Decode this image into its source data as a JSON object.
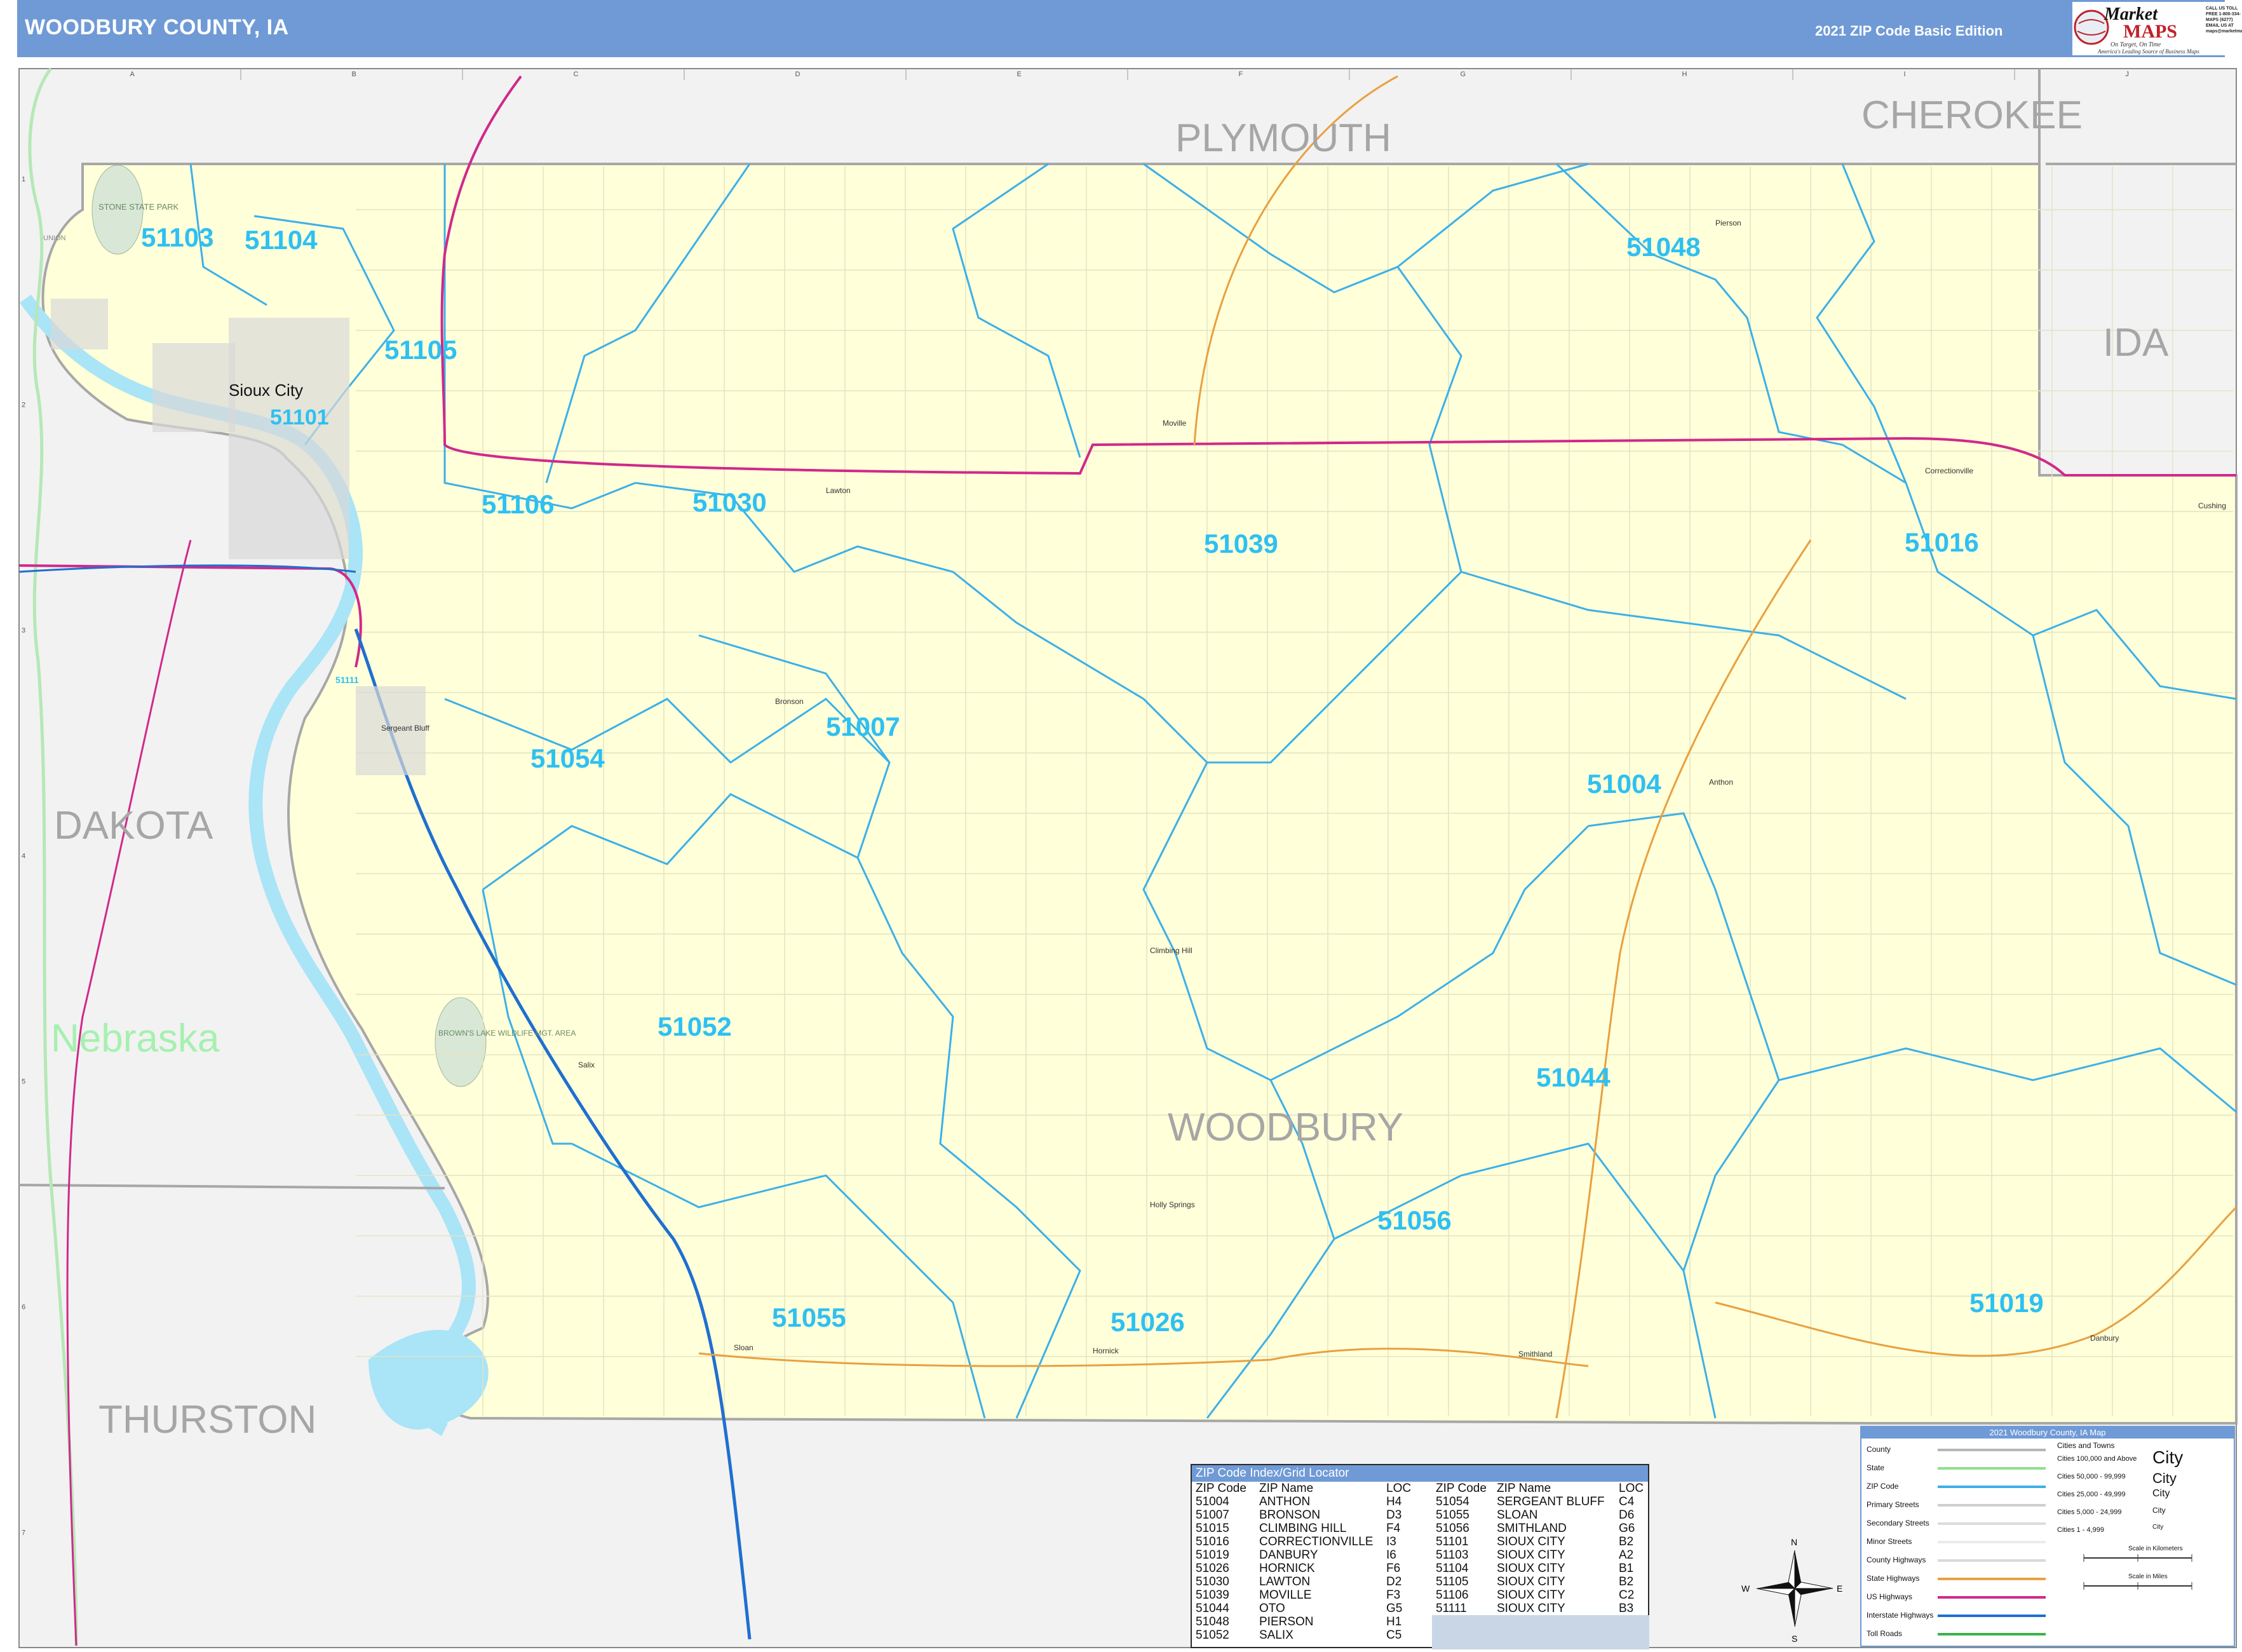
{
  "header": {
    "title": "WOODBURY COUNTY, IA",
    "edition": "2021 ZIP Code Basic Edition"
  },
  "logo": {
    "market": "Market",
    "maps": "MAPS",
    "tagline": "On Target, On Time",
    "tagline2": "America's Leading Source of Business Maps",
    "contact": "CALL US TOLL FREE 1-800-334-MAPS (6277) EMAIL US AT maps@marketmaps.com"
  },
  "grid": {
    "columns": [
      "A",
      "B",
      "C",
      "D",
      "E",
      "F",
      "G",
      "H",
      "I",
      "J"
    ],
    "rows": [
      "1",
      "2",
      "3",
      "4",
      "5",
      "6",
      "7"
    ]
  },
  "counties": [
    "PLYMOUTH",
    "CHEROKEE",
    "IDA",
    "DAKOTA",
    "THURSTON",
    "WOODBURY"
  ],
  "state_label": "Nebraska",
  "zip_labels": [
    {
      "zip": "51103"
    },
    {
      "zip": "51104"
    },
    {
      "zip": "51105"
    },
    {
      "zip": "51101"
    },
    {
      "zip": "51106"
    },
    {
      "zip": "51030"
    },
    {
      "zip": "51039"
    },
    {
      "zip": "51048"
    },
    {
      "zip": "51016"
    },
    {
      "zip": "51007"
    },
    {
      "zip": "51054"
    },
    {
      "zip": "51004"
    },
    {
      "zip": "51052"
    },
    {
      "zip": "51044"
    },
    {
      "zip": "51056"
    },
    {
      "zip": "51055"
    },
    {
      "zip": "51026"
    },
    {
      "zip": "51019"
    },
    {
      "zip": "51111"
    }
  ],
  "places": {
    "sioux_city": "Sioux City",
    "stone_state_park": "STONE STATE PARK",
    "union": "UNION",
    "browns_lake": "BROWN'S LAKE WILDLIFE MGT. AREA",
    "sergeant_bluff": "Sergeant Bluff",
    "bronson": "Bronson",
    "climbing_hill": "Climbing Hill",
    "holly_springs": "Holly Springs",
    "smithland": "Smithland",
    "danbury": "Danbury",
    "anthon": "Anthon",
    "correctionville": "Correctionville",
    "pierson": "Pierson",
    "moville": "Moville",
    "lawton": "Lawton",
    "salix": "Salix",
    "sloan": "Sloan",
    "hornick": "Hornick",
    "cushing": "Cushing"
  },
  "zip_index": {
    "title": "ZIP Code Index/Grid Locator",
    "headers": [
      "ZIP Code",
      "ZIP Name",
      "LOC"
    ],
    "left": [
      [
        "51004",
        "ANTHON",
        "H4"
      ],
      [
        "51007",
        "BRONSON",
        "D3"
      ],
      [
        "51015",
        "CLIMBING HILL",
        "F4"
      ],
      [
        "51016",
        "CORRECTIONVILLE",
        "I3"
      ],
      [
        "51019",
        "DANBURY",
        "I6"
      ],
      [
        "51026",
        "HORNICK",
        "F6"
      ],
      [
        "51030",
        "LAWTON",
        "D2"
      ],
      [
        "51039",
        "MOVILLE",
        "F3"
      ],
      [
        "51044",
        "OTO",
        "G5"
      ],
      [
        "51048",
        "PIERSON",
        "H1"
      ],
      [
        "51052",
        "SALIX",
        "C5"
      ]
    ],
    "right": [
      [
        "51054",
        "SERGEANT BLUFF",
        "C4"
      ],
      [
        "51055",
        "SLOAN",
        "D6"
      ],
      [
        "51056",
        "SMITHLAND",
        "G6"
      ],
      [
        "51101",
        "SIOUX CITY",
        "B2"
      ],
      [
        "51103",
        "SIOUX CITY",
        "A2"
      ],
      [
        "51104",
        "SIOUX CITY",
        "B1"
      ],
      [
        "51105",
        "SIOUX CITY",
        "B2"
      ],
      [
        "51106",
        "SIOUX CITY",
        "C2"
      ],
      [
        "51111",
        "SIOUX CITY",
        "B3"
      ]
    ]
  },
  "legend": {
    "title": "2021 Woodbury County, IA Map",
    "items": [
      {
        "label": "County",
        "color": "#b5b5b5"
      },
      {
        "label": "State",
        "color": "#8ee08e"
      },
      {
        "label": "ZIP Code",
        "color": "#3bb0e8"
      },
      {
        "label": "Primary Streets",
        "color": "#cfcfcf"
      },
      {
        "label": "Secondary Streets",
        "color": "#dcdcdc"
      },
      {
        "label": "Minor Streets",
        "color": "#ececec"
      },
      {
        "label": "County Highways",
        "color": "#d9d9d9"
      },
      {
        "label": "State Highways",
        "color": "#e8a040"
      },
      {
        "label": "US Highways",
        "color": "#d0298a"
      },
      {
        "label": "Interstate Highways",
        "color": "#1f6fd0"
      },
      {
        "label": "Toll Roads",
        "color": "#3cb24a"
      }
    ],
    "cities_title": "Cities and Towns",
    "cities": [
      {
        "label": "Cities 100,000 and Above",
        "name": "City"
      },
      {
        "label": "Cities 50,000 - 99,999",
        "name": "City"
      },
      {
        "label": "Cities 25,000 - 49,999",
        "name": "City"
      },
      {
        "label": "Cities 5,000 - 24,999",
        "name": "City"
      },
      {
        "label": "Cities 1 - 4,999",
        "name": "City"
      }
    ],
    "scale_km": "Scale in Kilometers",
    "scale_mi": "Scale in Miles"
  },
  "compass": {
    "n": "N",
    "s": "S",
    "e": "E",
    "w": "W"
  },
  "colors": {
    "header": "#6f9ad6",
    "county_fill": "#ffffd9",
    "outside_fill": "#f2f2f2",
    "zip_line": "#3bb0e8",
    "zip_label": "#2ec0f2",
    "county_label": "#a6a6a6",
    "state_label": "#a6f0b0",
    "water": "#a9e4f7",
    "us_highway": "#d0298a",
    "interstate": "#1f6fd0",
    "state_highway": "#e8a040"
  }
}
